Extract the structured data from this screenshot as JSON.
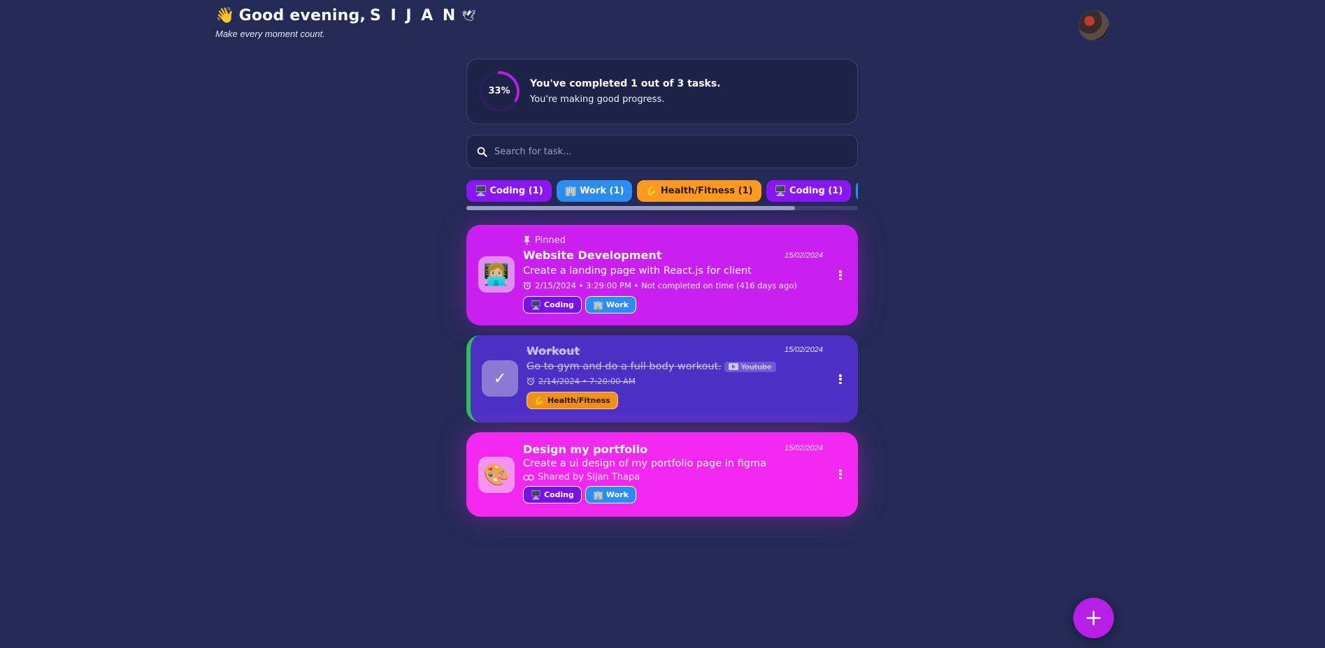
{
  "header": {
    "wave_emoji": "👋",
    "greeting_prefix": "Good evening,",
    "user_name": "S I J A N",
    "decoration": "🕊",
    "subtitle": "Make every moment count."
  },
  "progress": {
    "percent_label": "33%",
    "percent_value": 0.33,
    "title": "You've completed 1 out of 3 tasks.",
    "subtitle": "You're making good progress."
  },
  "search": {
    "placeholder": "Search for task..."
  },
  "categories": [
    {
      "emoji": "🖥️",
      "label": "Coding (1)"
    },
    {
      "emoji": "🏢",
      "label": "Work (1)"
    },
    {
      "emoji": "💪",
      "label": "Health/Fitness (1)"
    },
    {
      "emoji": "🖥️",
      "label": "Coding (1)"
    }
  ],
  "categories_scroll_fraction": 0.84,
  "tasks": [
    {
      "emoji": "👩🏼‍💻",
      "pinned_label": "Pinned",
      "title": "Website Development",
      "date": "15/02/2024",
      "description": "Create a landing page with React.js for client",
      "meta": "2/15/2024 • 3:29:00 PM • Not completed on time (416 days ago)",
      "tags": [
        {
          "emoji": "🖥️",
          "label": "Coding"
        },
        {
          "emoji": "🏢",
          "label": "Work"
        }
      ]
    },
    {
      "check": "✓",
      "title": "Workout",
      "date": "15/02/2024",
      "description": "Go to gym and do a full body workout.",
      "link_label": "Youtube",
      "meta": "2/14/2024 • 7:20:00 AM",
      "tags": [
        {
          "emoji": "💪",
          "label": "Health/Fitness"
        }
      ]
    },
    {
      "emoji": "🎨",
      "title": "Design my portfolio",
      "date": "15/02/2024",
      "description": "Create a ui design of my portfolio page in figma",
      "meta": "Shared by Sijan Thapa",
      "tags": [
        {
          "emoji": "🖥️",
          "label": "Coding"
        },
        {
          "emoji": "🏢",
          "label": "Work"
        }
      ]
    }
  ],
  "colors": {
    "background": "#232a55",
    "accent": "#b71ee6",
    "pinned_task": "#cb1ff2",
    "completed_task": "#4c30c5",
    "third_task": "#f227f0",
    "completed_border": "#2fbf55"
  }
}
